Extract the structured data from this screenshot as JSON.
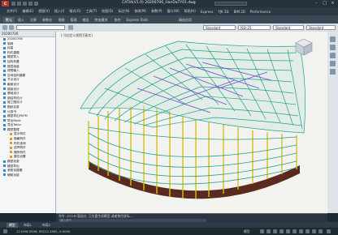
{
  "window": {
    "app_logo": "C",
    "title": "CATIA(V1.0)    20200706_HanDaTY01.dwg",
    "search_placeholder": ""
  },
  "menu": [
    "文件(F)",
    "编辑(E)",
    "视图(V)",
    "插入(I)",
    "格式(O)",
    "工具(T)",
    "绘图(D)",
    "标注(N)",
    "修改(M)",
    "参数(P)",
    "窗口(W)",
    "帮助(H)",
    "Express",
    "YJK 3D",
    "BIM 2D",
    "Performance"
  ],
  "ribbon_tabs": [
    "默认",
    "插入",
    "注释",
    "参数化",
    "视图",
    "管理",
    "输出",
    "附加模块",
    "协作",
    "Express Tools",
    "精选应用"
  ],
  "ribbon_active": 0,
  "toolbar": {
    "layer_value": "",
    "style1": "Standard",
    "style2": "ISO-25",
    "style3": "Standard",
    "style4": "Standard"
  },
  "left_panel": {
    "header": "20200706",
    "items": [
      {
        "label": "20200706",
        "sub": false
      },
      {
        "label": "轴网",
        "sub": false
      },
      {
        "label": "标高",
        "sub": false
      },
      {
        "label": "构件建模",
        "sub": false
      },
      {
        "label": "模型导入",
        "sub": false
      },
      {
        "label": "结构布置",
        "sub": false
      },
      {
        "label": "楼层组装",
        "sub": false
      },
      {
        "label": "荷载输入",
        "sub": false
      },
      {
        "label": "空间结构建模",
        "sub": false
      },
      {
        "label": "节点设计",
        "sub": false
      },
      {
        "label": "截面设计",
        "sub": false
      },
      {
        "label": "楼板设计",
        "sub": false
      },
      {
        "label": "基础设计",
        "sub": false
      },
      {
        "label": "钢结构设计",
        "sub": false
      },
      {
        "label": "施工图设计",
        "sub": false
      },
      {
        "label": "图纸目录",
        "sub": false
      },
      {
        "label": "计算书",
        "sub": false
      },
      {
        "label": "模型导出PKPM",
        "sub": false
      },
      {
        "label": "导出Revit",
        "sub": false
      },
      {
        "label": "导出Tekla",
        "sub": false
      },
      {
        "label": "模型整理",
        "sub": false
      },
      {
        "label": "显示构件",
        "sub": true
      },
      {
        "label": "隐藏构件",
        "sub": true
      },
      {
        "label": "构件查询",
        "sub": true
      },
      {
        "label": "选择构件",
        "sub": true
      },
      {
        "label": "删除构件",
        "sub": true
      },
      {
        "label": "属性设置",
        "sub": true
      },
      {
        "label": "模型检查",
        "sub": false
      },
      {
        "label": "模型导出",
        "sub": false
      },
      {
        "label": "参数化建模",
        "sub": false
      },
      {
        "label": "辅助功能",
        "sub": false
      }
    ]
  },
  "drawing": {
    "caption": "[-][自定义视图][真实]",
    "viewcube_label": "上"
  },
  "command": {
    "history": "命令: ZOOM  窗选点,  正在重生成模型,或者按住鼠标...",
    "input_placeholder": "键入命令"
  },
  "layout_tabs": [
    "模型",
    "布局1",
    "布局2"
  ],
  "layout_active": 0,
  "status": {
    "coords": "121456.2556, 95212.4562, 0.0000",
    "model_label": "模型"
  },
  "colors": {
    "frame": "#1fa08a",
    "column": "#d4c21c",
    "brace": "#6a4fc9",
    "base": "#5a2a1e"
  }
}
